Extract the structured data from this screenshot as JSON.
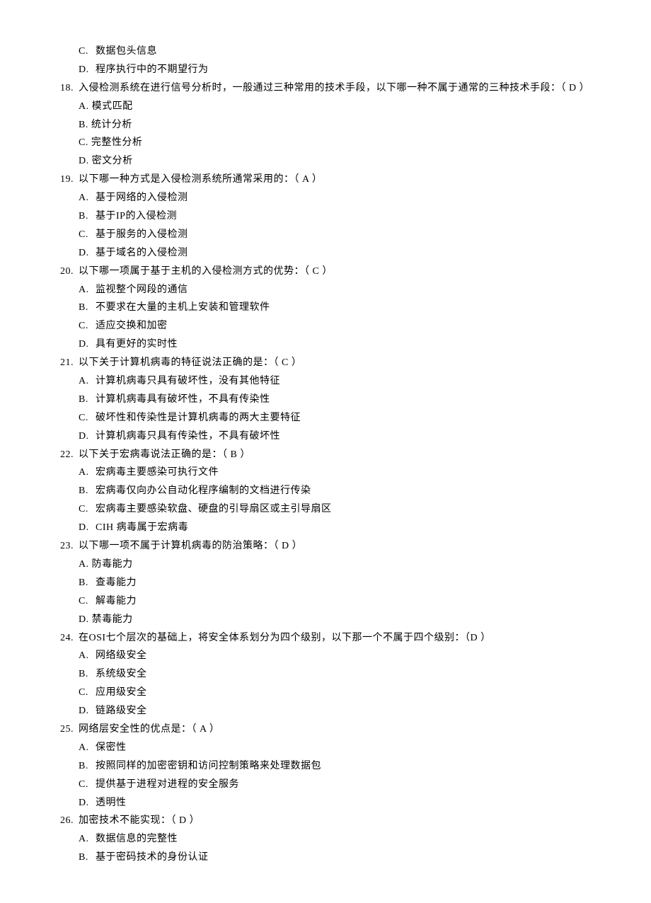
{
  "orphan_options": [
    {
      "label": "C.",
      "text": "数据包头信息"
    },
    {
      "label": "D.",
      "text": "程序执行中的不期望行为"
    }
  ],
  "questions": [
    {
      "num": "18.",
      "stem": "入侵检测系统在进行信号分析时，一般通过三种常用的技术手段，以下哪一种不属于通常的三种技术手段：（ D ）",
      "options": [
        {
          "label": "A.",
          "text": "模式匹配",
          "tight": true
        },
        {
          "label": "B.",
          "text": "统计分析",
          "tight": true
        },
        {
          "label": "C.",
          "text": "完整性分析",
          "tight": true
        },
        {
          "label": "D.",
          "text": "密文分析",
          "tight": true
        }
      ]
    },
    {
      "num": "19.",
      "stem": "以下哪一种方式是入侵检测系统所通常采用的：（ A ）",
      "options": [
        {
          "label": "A.",
          "text": "基于网络的入侵检测"
        },
        {
          "label": "B.",
          "text": "基于IP的入侵检测"
        },
        {
          "label": "C.",
          "text": "基于服务的入侵检测"
        },
        {
          "label": "D.",
          "text": "基于域名的入侵检测"
        }
      ]
    },
    {
      "num": "20.",
      "stem": "以下哪一项属于基于主机的入侵检测方式的优势：（ C ）",
      "options": [
        {
          "label": "A.",
          "text": "监视整个网段的通信"
        },
        {
          "label": "B.",
          "text": "不要求在大量的主机上安装和管理软件"
        },
        {
          "label": "C.",
          "text": "适应交换和加密"
        },
        {
          "label": "D.",
          "text": "具有更好的实时性"
        }
      ]
    },
    {
      "num": "21.",
      "stem": "以下关于计算机病毒的特征说法正确的是：（ C ）",
      "options": [
        {
          "label": "A.",
          "text": "计算机病毒只具有破坏性，没有其他特征"
        },
        {
          "label": "B.",
          "text": "计算机病毒具有破坏性，不具有传染性"
        },
        {
          "label": "C.",
          "text": "破坏性和传染性是计算机病毒的两大主要特征"
        },
        {
          "label": "D.",
          "text": "计算机病毒只具有传染性，不具有破坏性"
        }
      ]
    },
    {
      "num": "22.",
      "stem": "以下关于宏病毒说法正确的是：（ B ）",
      "options": [
        {
          "label": "A.",
          "text": "宏病毒主要感染可执行文件"
        },
        {
          "label": "B.",
          "text": "宏病毒仅向办公自动化程序编制的文档进行传染"
        },
        {
          "label": "C.",
          "text": "宏病毒主要感染软盘、硬盘的引导扇区或主引导扇区"
        },
        {
          "label": "D.",
          "text": "CIH 病毒属于宏病毒"
        }
      ]
    },
    {
      "num": "23.",
      "stem": "以下哪一项不属于计算机病毒的防治策略：（ D ）",
      "options": [
        {
          "label": "A.",
          "text": "防毒能力",
          "tight": true
        },
        {
          "label": "B.",
          "text": "查毒能力"
        },
        {
          "label": "C.",
          "text": "解毒能力"
        },
        {
          "label": "D.",
          "text": "禁毒能力",
          "tight": true
        }
      ]
    },
    {
      "num": "24.",
      "stem": "在OSI七个层次的基础上，将安全体系划分为四个级别，以下那一个不属于四个级别：（D ）",
      "options": [
        {
          "label": "A.",
          "text": "网络级安全"
        },
        {
          "label": "B.",
          "text": "系统级安全"
        },
        {
          "label": "C.",
          "text": "应用级安全"
        },
        {
          "label": "D.",
          "text": "链路级安全"
        }
      ]
    },
    {
      "num": "25.",
      "stem": "网络层安全性的优点是：（ A ）",
      "options": [
        {
          "label": "A.",
          "text": "保密性"
        },
        {
          "label": "B.",
          "text": "按照同样的加密密钥和访问控制策略来处理数据包"
        },
        {
          "label": "C.",
          "text": "提供基于进程对进程的安全服务"
        },
        {
          "label": "D.",
          "text": "透明性"
        }
      ]
    },
    {
      "num": "26.",
      "stem": "加密技术不能实现：（ D ）",
      "options": [
        {
          "label": "A.",
          "text": "数据信息的完整性"
        },
        {
          "label": "B.",
          "text": "基于密码技术的身份认证"
        }
      ]
    }
  ]
}
